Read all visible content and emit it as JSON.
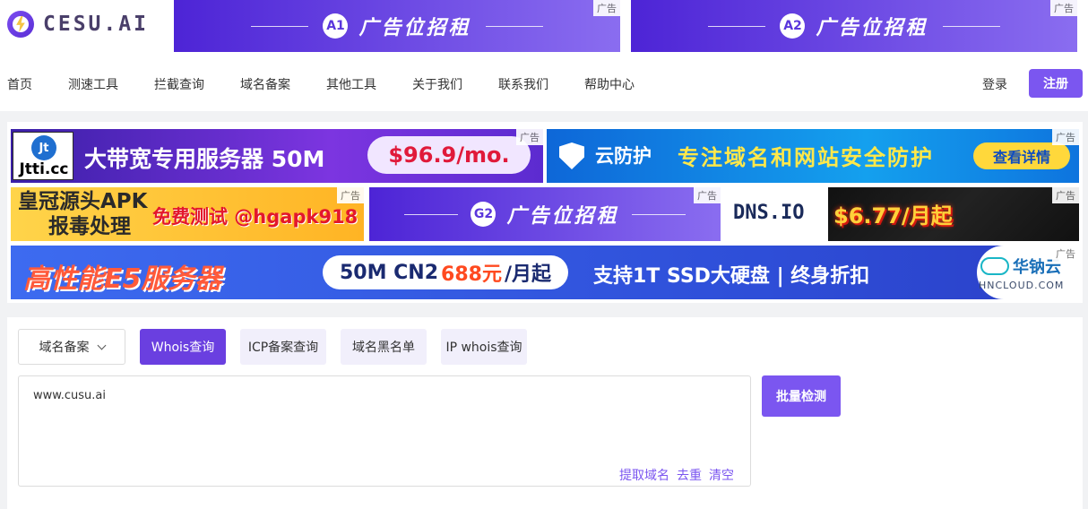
{
  "brand": {
    "logo_text": "CESU.AI"
  },
  "top_ads": [
    {
      "badge": "A1",
      "text": "广告位招租",
      "tag": "广告"
    },
    {
      "badge": "A2",
      "text": "广告位招租",
      "tag": "广告"
    }
  ],
  "nav": {
    "items": [
      "首页",
      "测速工具",
      "拦截查询",
      "域名备案",
      "其他工具",
      "关于我们",
      "联系我们",
      "帮助中心"
    ],
    "login": "登录",
    "register": "注册"
  },
  "ads": {
    "tag": "广告",
    "jtti": {
      "logo_mark": "Jt",
      "logo_text": "Jtti.cc",
      "text": "大带宽专用服务器 50M",
      "price": "$96.9/mo."
    },
    "cloud_protect": {
      "title": "云防护",
      "slogan": "专注域名和网站安全防护",
      "button": "查看详情"
    },
    "apk": {
      "line1": "皇冠源头APK",
      "line2": "报毒处理",
      "promo": "免费测试 @hgapk918"
    },
    "g2": {
      "badge": "G2",
      "text": "广告位招租"
    },
    "dnsio": {
      "brand": "DNS.IO",
      "price": "$6.77/月起"
    },
    "e5": {
      "title": "高性能E5服务器",
      "pill_a": "50M CN2",
      "pill_price": "688元",
      "pill_b": "/月起",
      "slogan": "支持1T SSD大硬盘 | 终身折扣",
      "brand_cn": "华钠云",
      "brand_en": "HNCLOUD.COM"
    }
  },
  "tool": {
    "select_value": "域名备案",
    "tabs": [
      "Whois查询",
      "ICP备案查询",
      "域名黑名单",
      "IP whois查询"
    ],
    "active_tab": 0,
    "textarea_value": "www.cusu.ai",
    "links": [
      "提取域名",
      "去重",
      "清空"
    ],
    "batch_button": "批量检测"
  },
  "colors": {
    "accent": "#7b56f0",
    "ad_purple_start": "#4d24d6",
    "ad_purple_end": "#8a6df0"
  }
}
